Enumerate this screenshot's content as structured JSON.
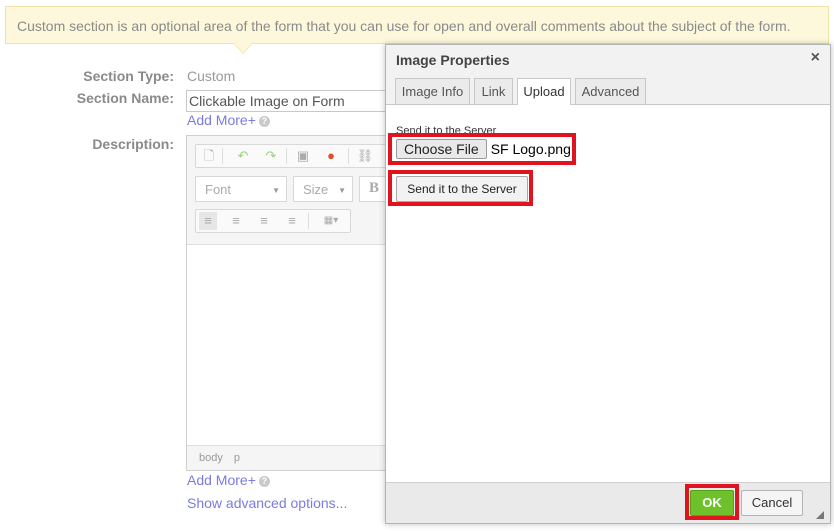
{
  "banner": {
    "text": "Custom section is an optional area of the form that you can use for open and overall comments about the subject of the form."
  },
  "form": {
    "section_type_label": "Section Type:",
    "section_type_value": "Custom",
    "section_name_label": "Section Name:",
    "section_name_value": "Clickable Image on Form",
    "add_more_1": "Add More+",
    "description_label": "Description:",
    "add_more_2": "Add More+",
    "show_advanced": "Show advanced options..."
  },
  "editor": {
    "font_combo": "Font",
    "size_combo": "Size",
    "bold": "B",
    "path": [
      "body",
      "p"
    ]
  },
  "dialog": {
    "title": "Image Properties",
    "close": "×",
    "tabs": [
      {
        "label": "Image Info"
      },
      {
        "label": "Link"
      },
      {
        "label": "Upload"
      },
      {
        "label": "Advanced"
      }
    ],
    "active_tab": "Upload",
    "send_label": "Send it to the Server",
    "choose_file": "Choose File",
    "file_name": "SF Logo.png",
    "send_button": "Send it to the Server",
    "ok": "OK",
    "cancel": "Cancel"
  },
  "colors": {
    "highlight": "#e0141e",
    "ok": "#6ec12a",
    "link": "#7b7be0",
    "banner": "#fdf8dc"
  }
}
